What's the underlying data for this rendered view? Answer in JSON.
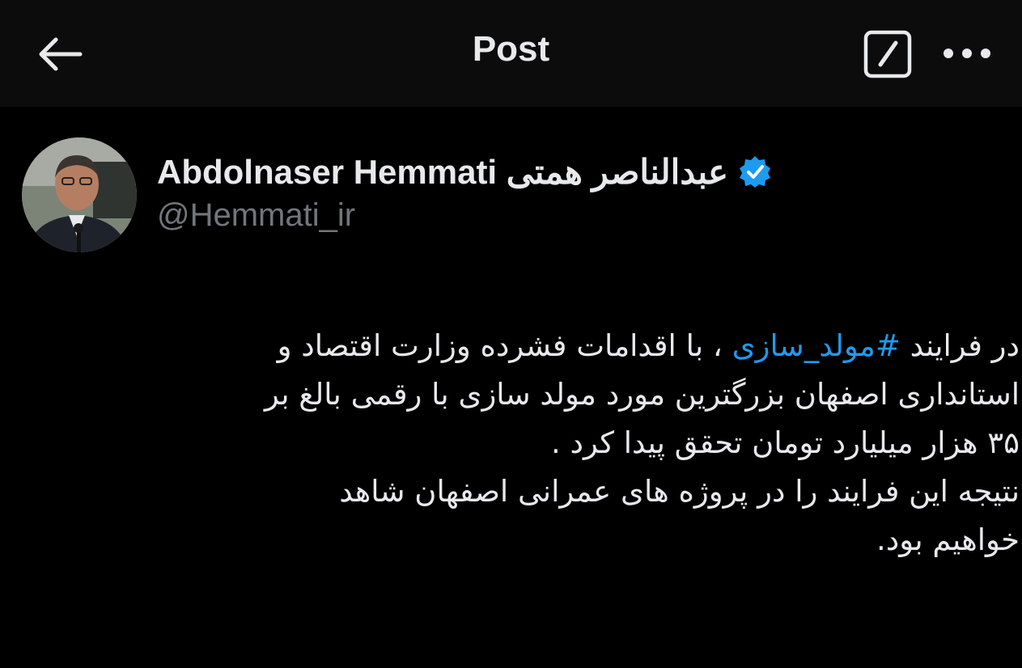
{
  "header": {
    "title": "Post",
    "back_icon": "arrow-left-icon",
    "edit_icon": "edit-square-icon",
    "more_icon": "more-horizontal-icon"
  },
  "author": {
    "display_name": "Abdolnaser Hemmati عبدالناصر همتی",
    "handle": "@Hemmati_ir",
    "verified_icon": "verified-badge-icon",
    "verified_color": "#1d9bf0"
  },
  "tweet": {
    "line1_prefix": "در فرایند ",
    "hashtag": "#مولد_سازی",
    "line1_suffix": " ، با اقدامات فشرده وزارت اقتصاد و",
    "line2": "استانداری اصفهان بزرگترین مورد مولد سازی با رقمی بالغ بر",
    "line3": "۳۵ هزار میلیارد تومان تحقق پیدا کرد .",
    "line4": "نتیجه این فرایند را در پروژه های  عمرانی اصفهان شاهد",
    "line5": "خواهیم بود."
  },
  "colors": {
    "background": "#000000",
    "header_background": "#0c0c0c",
    "text": "#e7e9ea",
    "secondary_text": "#71767b",
    "link": "#1d9bf0"
  }
}
